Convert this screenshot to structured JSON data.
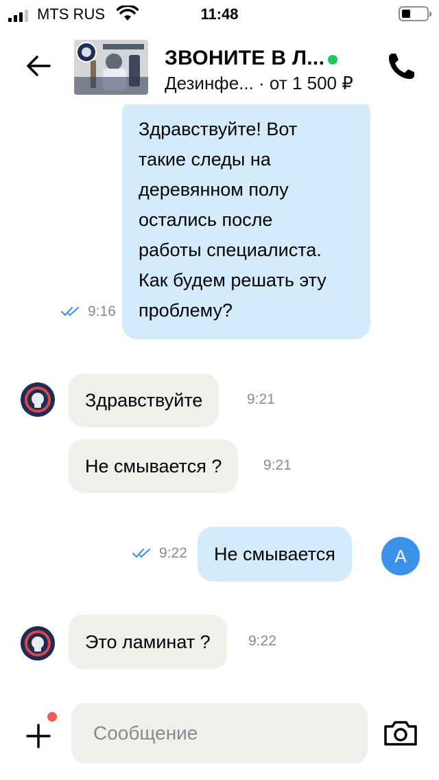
{
  "status_bar": {
    "carrier": "MTS RUS",
    "time": "11:48"
  },
  "header": {
    "title": "ЗВОНИТЕ В Л...",
    "subtitle": "Дезинфе... · от 1 500 ₽",
    "online_color": "#22c55e"
  },
  "messages": [
    {
      "direction": "outgoing",
      "text": "Здравствуйте! Вот\nтакие следы на\nдеревянном полу\nостались после\nработы специалиста.\nКак будем решать эту\nпроблему?",
      "time": "9:16",
      "read": true
    },
    {
      "direction": "incoming",
      "text": "Здравствуйте",
      "time": "9:21"
    },
    {
      "direction": "incoming",
      "text": "Не смывается ?",
      "time": "9:21"
    },
    {
      "direction": "outgoing",
      "text": "Не смывается",
      "time": "9:22",
      "read": true
    },
    {
      "direction": "incoming",
      "text": "Это ламинат ?",
      "time": "9:22"
    }
  ],
  "user_avatar_letter": "А",
  "input": {
    "placeholder": "Сообщение"
  },
  "colors": {
    "outgoing_bubble": "#d4ebfc",
    "incoming_bubble": "#f1efec",
    "read_check": "#3a93e9",
    "notification_dot": "#f25a5a"
  }
}
